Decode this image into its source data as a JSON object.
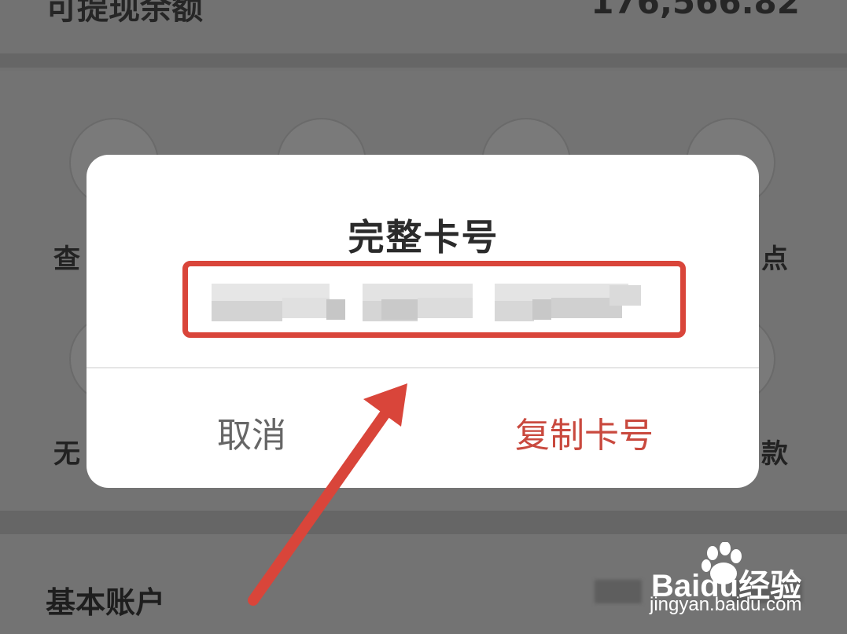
{
  "background": {
    "top_text": "可提现余额",
    "top_number": "176,566.82",
    "grid_labels_left": [
      "查",
      "无"
    ],
    "grid_labels_right": [
      "点",
      "款"
    ],
    "section_title": "基本账户"
  },
  "dialog": {
    "title": "完整卡号",
    "card_number_state": "pixelated",
    "cancel_label": "取消",
    "copy_label": "复制卡号"
  },
  "annotation": {
    "highlight_color": "#d9453a",
    "arrow_color": "#d9453a"
  },
  "watermark": {
    "brand": "Baidu经验",
    "url": "jingyan.baidu.com"
  },
  "colors": {
    "accent": "#c9493e",
    "overlay": "#717171",
    "dialog_bg": "#ffffff"
  }
}
